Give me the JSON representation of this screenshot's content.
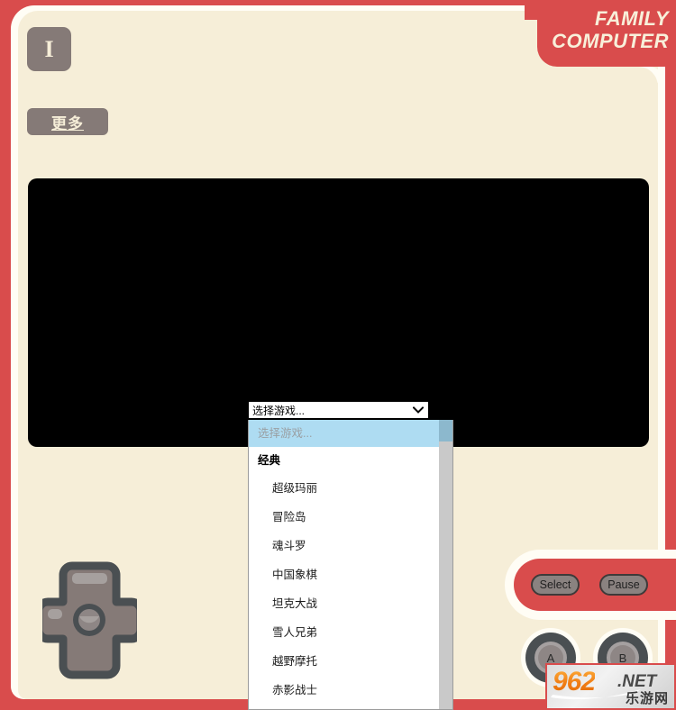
{
  "brand": {
    "line1": "FAMILY",
    "line2": "COMPUTER"
  },
  "toolbar": {
    "power_label": "I",
    "more_label": "更多"
  },
  "game_select": {
    "selected_value": "选择游戏...",
    "placeholder_option": "选择游戏...",
    "group_label": "经典",
    "options": [
      "超级玛丽",
      "冒险岛",
      "魂斗罗",
      "中国象棋",
      "坦克大战",
      "雪人兄弟",
      "越野摩托",
      "赤影战士"
    ]
  },
  "controls": {
    "select_label": "Select",
    "pause_label": "Pause",
    "a_label": "A",
    "b_label": "B"
  },
  "watermark": {
    "number": "962",
    "tld": ".NET",
    "chinese": "乐游网"
  },
  "colors": {
    "frame_red": "#d94c4c",
    "body_cream": "#f6eed8",
    "white_gap": "#fffdf5",
    "screen_black": "#000000",
    "button_gray": "#857a77",
    "highlight_blue": "#aedcf2",
    "scrollbar_gray": "#c9c9c9"
  }
}
